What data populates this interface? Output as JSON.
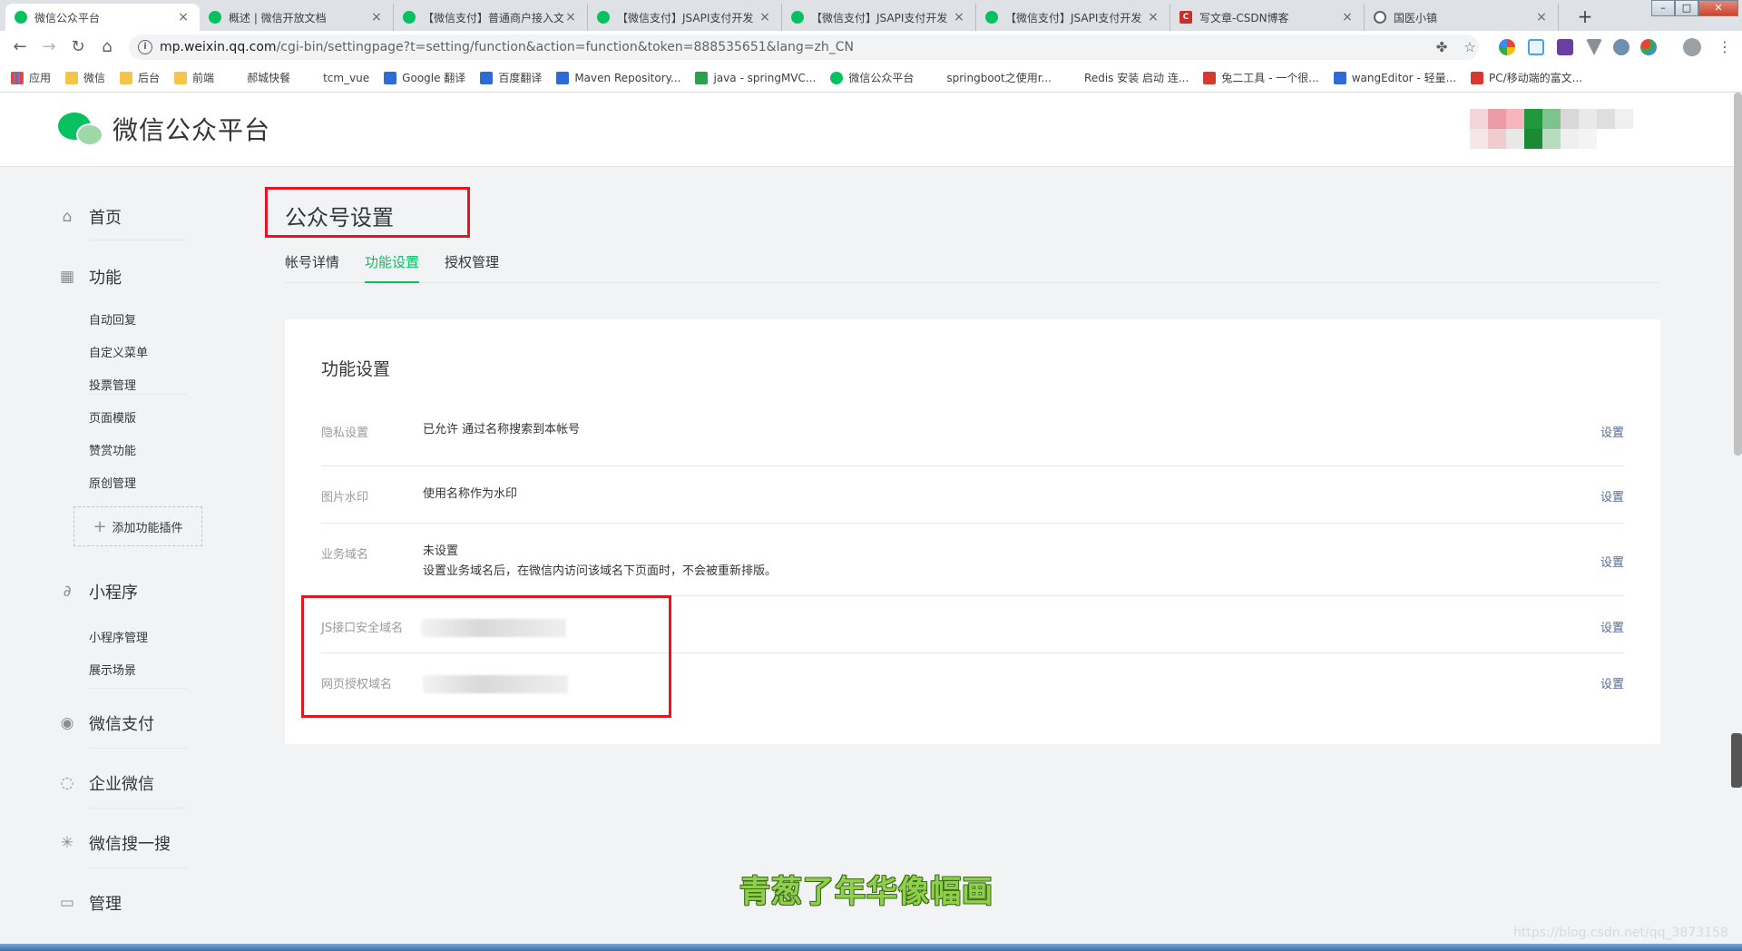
{
  "browser": {
    "tabs": [
      {
        "title": "微信公众平台",
        "icon": "wechat-icon",
        "active": true
      },
      {
        "title": "概述 | 微信开放文档",
        "icon": "wechat-icon",
        "active": false
      },
      {
        "title": "【微信支付】普通商户接入文",
        "icon": "wechat-icon",
        "active": false
      },
      {
        "title": "【微信支付】JSAPI支付开发",
        "icon": "wechat-icon",
        "active": false
      },
      {
        "title": "【微信支付】JSAPI支付开发",
        "icon": "wechat-icon",
        "active": false
      },
      {
        "title": "【微信支付】JSAPI支付开发",
        "icon": "wechat-icon",
        "active": false
      },
      {
        "title": "写文章-CSDN博客",
        "icon": "csdn-icon",
        "active": false
      },
      {
        "title": "国医小镇",
        "icon": "globe-icon",
        "active": false
      }
    ],
    "tab_close": "×",
    "new_tab": "+",
    "window_controls": {
      "minimize": "–",
      "maximize": "□",
      "close": "✕"
    },
    "nav": {
      "back": "←",
      "forward": "→",
      "reload": "↻",
      "home": "⌂"
    },
    "address": {
      "host": "mp.weixin.qq.com",
      "path": "/cgi-bin/settingpage?t=setting/function&action=function&token=888535651&lang=zh_CN",
      "info": "i"
    },
    "omnibox_icons": {
      "extension": "✤",
      "star": "☆"
    },
    "menu": "⋮",
    "bookmarks": [
      {
        "label": "应用",
        "icon": "apps"
      },
      {
        "label": "微信",
        "icon": "folder"
      },
      {
        "label": "后台",
        "icon": "folder"
      },
      {
        "label": "前端",
        "icon": "folder"
      },
      {
        "label": "郝城快餐",
        "icon": "globe"
      },
      {
        "label": "tcm_vue",
        "icon": "globe"
      },
      {
        "label": "Google 翻译",
        "icon": "blue"
      },
      {
        "label": "百度翻译",
        "icon": "blue"
      },
      {
        "label": "Maven Repository...",
        "icon": "blue"
      },
      {
        "label": "java - springMVC...",
        "icon": "green"
      },
      {
        "label": "微信公众平台",
        "icon": "wxb"
      },
      {
        "label": "springboot之使用r...",
        "icon": "globe"
      },
      {
        "label": "Redis 安装 启动 连...",
        "icon": "globe"
      },
      {
        "label": "兔二工具 - 一个很...",
        "icon": "red"
      },
      {
        "label": "wangEditor - 轻量...",
        "icon": "blue"
      },
      {
        "label": "PC/移动端的富文...",
        "icon": "red"
      }
    ]
  },
  "header": {
    "brand": "微信公众平台"
  },
  "sidebar": {
    "groups": [
      {
        "label": "首页",
        "icon": "home-icon",
        "glyph": "⌂",
        "items": []
      },
      {
        "label": "功能",
        "icon": "grid-icon",
        "glyph": "▦",
        "items": [
          "自动回复",
          "自定义菜单",
          "投票管理",
          "页面模版",
          "赞赏功能",
          "原创管理"
        ]
      },
      {
        "label": "小程序",
        "icon": "miniprogram-icon",
        "glyph": "∂",
        "items": [
          "小程序管理",
          "展示场景"
        ]
      },
      {
        "label": "微信支付",
        "icon": "pay-icon",
        "glyph": "◉",
        "items": []
      },
      {
        "label": "企业微信",
        "icon": "enterprise-icon",
        "glyph": "◌",
        "items": []
      },
      {
        "label": "微信搜一搜",
        "icon": "search-icon",
        "glyph": "✳",
        "items": []
      },
      {
        "label": "管理",
        "icon": "inbox-icon",
        "glyph": "▭",
        "items": []
      }
    ],
    "add_plugin": "添加功能插件",
    "add_plugin_plus": "+"
  },
  "main": {
    "title": "公众号设置",
    "tabs": [
      {
        "label": "帐号详情",
        "active": false
      },
      {
        "label": "功能设置",
        "active": true
      },
      {
        "label": "授权管理",
        "active": false
      }
    ],
    "card": {
      "title": "功能设置",
      "rows": [
        {
          "label": "隐私设置",
          "value": "已允许 通过名称搜索到本帐号",
          "action": "设置"
        },
        {
          "label": "图片水印",
          "value": "使用名称作为水印",
          "action": "设置"
        },
        {
          "label": "业务域名",
          "value": "未设置",
          "value2": "设置业务域名后，在微信内访问该域名下页面时，不会被重新排版。",
          "action": "设置"
        },
        {
          "label": "JS接口安全域名",
          "value": "",
          "action": "设置"
        },
        {
          "label": "网页授权域名",
          "value": "",
          "action": "设置"
        }
      ]
    }
  },
  "caption": "青葱了年华像幅画",
  "watermark": "https://blog.csdn.net/qq_3873158",
  "colors": {
    "accent": "#07c160",
    "link": "#576b95",
    "highlight": "#e8141e"
  }
}
